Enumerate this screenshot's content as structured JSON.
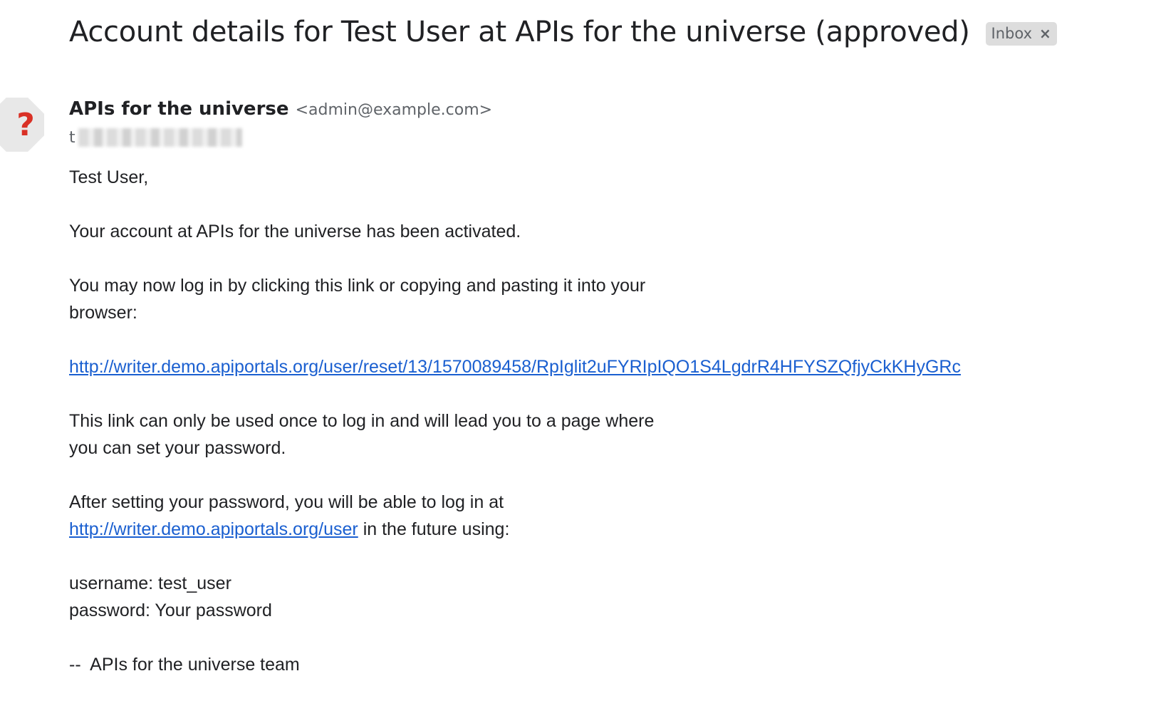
{
  "email": {
    "subject": "Account details for Test User at APIs for the universe (approved)",
    "label": "Inbox",
    "label_remove_glyph": "×",
    "avatar_glyph": "?",
    "sender": {
      "name": "APIs for the universe",
      "email": "<admin@example.com>"
    },
    "recipient_prefix": "t",
    "body": {
      "greeting": "Test User,",
      "activation": "Your account at APIs for the universe has been activated.",
      "login_intro_line1": "You may now log in by clicking this link or copying and pasting it into your",
      "login_intro_line2": "browser:",
      "reset_link": "http://writer.demo.apiportals.org/user/reset/13/1570089458/RpIglit2uFYRIpIQO1S4LgdrR4HFYSZQfjyCkKHyGRc",
      "once_line1": "This link can only be used once to log in and will lead you to a page where",
      "once_line2": "you can set your password.",
      "after_line1": "After setting your password, you will be able to log in at",
      "user_link": "http://writer.demo.apiportals.org/user",
      "after_line2_suffix": " in the future using:",
      "username_line": "username: test_user",
      "password_line": "password: Your password",
      "signature": "--  APIs for the universe team"
    }
  },
  "colors": {
    "link": "#1a5fd0",
    "avatar_glyph": "#d93025",
    "chip_background": "#dddddd"
  }
}
